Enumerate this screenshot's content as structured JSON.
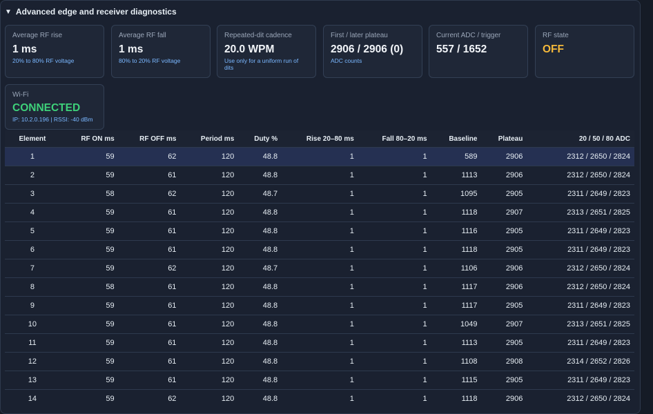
{
  "section": {
    "title": "Advanced edge and receiver diagnostics"
  },
  "cards": [
    {
      "label": "Average RF rise",
      "value": "1 ms",
      "sub": "20% to 80% RF voltage"
    },
    {
      "label": "Average RF fall",
      "value": "1 ms",
      "sub": "80% to 20% RF voltage"
    },
    {
      "label": "Repeated-dit cadence",
      "value": "20.0 WPM",
      "sub": "Use only for a uniform run of dits"
    },
    {
      "label": "First / later plateau",
      "value": "2906 / 2906 (0)",
      "sub": "ADC counts"
    },
    {
      "label": "Current ADC / trigger",
      "value": "557 / 1652",
      "sub": ""
    },
    {
      "label": "RF state",
      "value": "OFF",
      "sub": ""
    },
    {
      "label": "Wi-Fi",
      "value": "CONNECTED",
      "sub": "IP: 10.2.0.196 | RSSI: -40 dBm"
    }
  ],
  "colors": {
    "state_off": "#f5b93a",
    "wifi_connected": "#3ed17a",
    "sub_text": "#7ab7ff",
    "selected_row": "#253052"
  },
  "table": {
    "headers": [
      "Element",
      "RF ON ms",
      "RF OFF ms",
      "Period ms",
      "Duty %",
      "Rise 20–80 ms",
      "Fall 80–20 ms",
      "Baseline",
      "Plateau",
      "20 / 50 / 80 ADC"
    ],
    "rows": [
      [
        "1",
        "59",
        "62",
        "120",
        "48.8",
        "1",
        "1",
        "589",
        "2906",
        "2312 / 2650 / 2824"
      ],
      [
        "2",
        "59",
        "61",
        "120",
        "48.8",
        "1",
        "1",
        "1113",
        "2906",
        "2312 / 2650 / 2824"
      ],
      [
        "3",
        "58",
        "62",
        "120",
        "48.7",
        "1",
        "1",
        "1095",
        "2905",
        "2311 / 2649 / 2823"
      ],
      [
        "4",
        "59",
        "61",
        "120",
        "48.8",
        "1",
        "1",
        "1118",
        "2907",
        "2313 / 2651 / 2825"
      ],
      [
        "5",
        "59",
        "61",
        "120",
        "48.8",
        "1",
        "1",
        "1116",
        "2905",
        "2311 / 2649 / 2823"
      ],
      [
        "6",
        "59",
        "61",
        "120",
        "48.8",
        "1",
        "1",
        "1118",
        "2905",
        "2311 / 2649 / 2823"
      ],
      [
        "7",
        "59",
        "62",
        "120",
        "48.7",
        "1",
        "1",
        "1106",
        "2906",
        "2312 / 2650 / 2824"
      ],
      [
        "8",
        "58",
        "61",
        "120",
        "48.8",
        "1",
        "1",
        "1117",
        "2906",
        "2312 / 2650 / 2824"
      ],
      [
        "9",
        "59",
        "61",
        "120",
        "48.8",
        "1",
        "1",
        "1117",
        "2905",
        "2311 / 2649 / 2823"
      ],
      [
        "10",
        "59",
        "61",
        "120",
        "48.8",
        "1",
        "1",
        "1049",
        "2907",
        "2313 / 2651 / 2825"
      ],
      [
        "11",
        "59",
        "61",
        "120",
        "48.8",
        "1",
        "1",
        "1113",
        "2905",
        "2311 / 2649 / 2823"
      ],
      [
        "12",
        "59",
        "61",
        "120",
        "48.8",
        "1",
        "1",
        "1108",
        "2908",
        "2314 / 2652 / 2826"
      ],
      [
        "13",
        "59",
        "61",
        "120",
        "48.8",
        "1",
        "1",
        "1115",
        "2905",
        "2311 / 2649 / 2823"
      ],
      [
        "14",
        "59",
        "62",
        "120",
        "48.8",
        "1",
        "1",
        "1118",
        "2906",
        "2312 / 2650 / 2824"
      ]
    ]
  }
}
